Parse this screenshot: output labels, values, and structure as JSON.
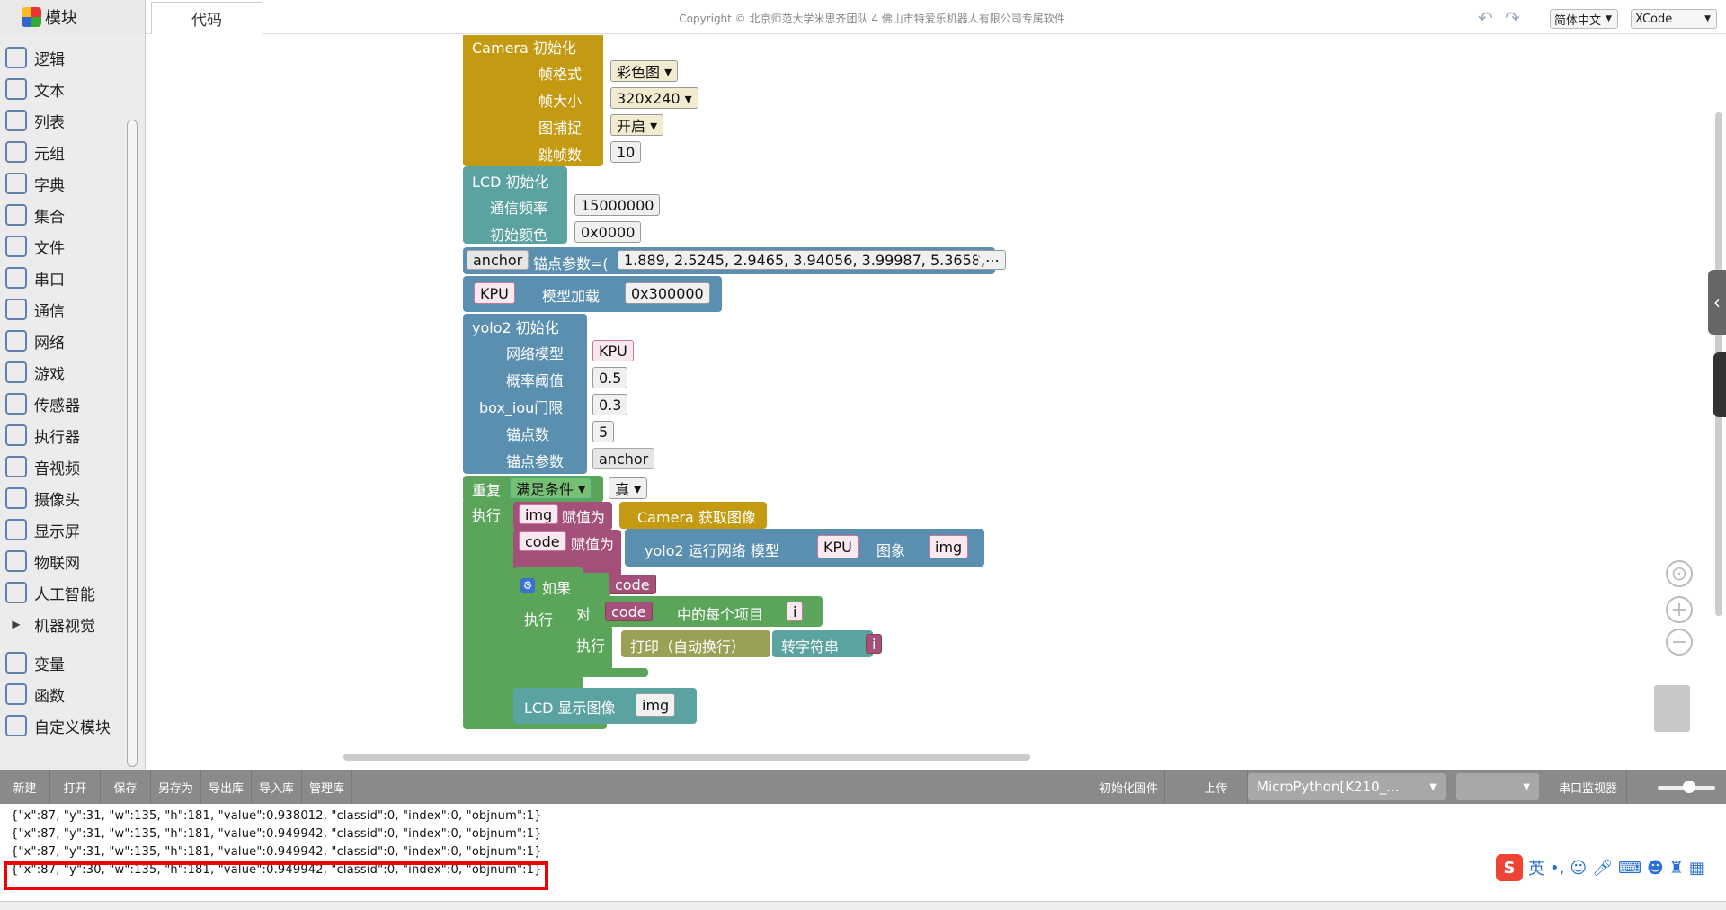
{
  "topbar": {
    "modules_tab": "模块",
    "code_tab": "代码",
    "copyright": "Copyright © 北京师范大学米思齐团队 4 佛山市特爱乐机器人有限公司专属软件",
    "language": "简体中文",
    "theme": "XCode"
  },
  "sidebar": {
    "items": [
      {
        "label": "逻辑",
        "icon": "logic-icon"
      },
      {
        "label": "文本",
        "icon": "text-icon"
      },
      {
        "label": "列表",
        "icon": "list-icon"
      },
      {
        "label": "元组",
        "icon": "tuple-icon"
      },
      {
        "label": "字典",
        "icon": "dict-icon"
      },
      {
        "label": "集合",
        "icon": "set-icon"
      },
      {
        "label": "文件",
        "icon": "file-icon"
      },
      {
        "label": "串口",
        "icon": "serial-icon"
      },
      {
        "label": "通信",
        "icon": "comm-icon"
      },
      {
        "label": "网络",
        "icon": "network-icon"
      },
      {
        "label": "游戏",
        "icon": "game-icon"
      },
      {
        "label": "传感器",
        "icon": "sensor-icon"
      },
      {
        "label": "执行器",
        "icon": "actuator-icon"
      },
      {
        "label": "音视频",
        "icon": "av-icon"
      },
      {
        "label": "摄像头",
        "icon": "camera-icon"
      },
      {
        "label": "显示屏",
        "icon": "display-icon"
      },
      {
        "label": "物联网",
        "icon": "iot-icon"
      },
      {
        "label": "人工智能",
        "icon": "ai-icon"
      },
      {
        "label": "机器视觉",
        "icon": "caret-right-icon"
      },
      {
        "label": "变量",
        "icon": "variable-icon"
      },
      {
        "label": "函数",
        "icon": "function-icon"
      },
      {
        "label": "自定义模块",
        "icon": "custom-module-icon"
      }
    ]
  },
  "blocks": {
    "camera_init": "Camera  初始化",
    "frame_format_lbl": "帧格式",
    "frame_format_val": "彩色图",
    "frame_size_lbl": "帧大小",
    "frame_size_val": "320x240",
    "capture_lbl": "图捕捉",
    "capture_val": "开启",
    "skip_lbl": "跳帧数",
    "skip_val": "10",
    "lcd_init": "LCD 初始化",
    "freq_lbl": "通信频率",
    "freq_val": "15000000",
    "color_lbl": "初始颜色",
    "color_val": "0x0000",
    "anchor_var": "anchor",
    "anchor_lbl": "锚点参数=(",
    "anchor_val": "1.889, 2.5245, 2.9465, 3.94056, 3.99987, 5.3658,⋯",
    "anchor_close": ")",
    "kpu_var": "KPU",
    "model_load_lbl": "模型加载",
    "model_load_val": "0x300000",
    "yolo_init": "yolo2  初始化",
    "net_model_lbl": "网络模型",
    "net_model_val": "KPU",
    "prob_lbl": "概率阈值",
    "prob_val": "0.5",
    "iou_lbl": "box_iou门限",
    "iou_val": "0.3",
    "anchor_num_lbl": "锚点数",
    "anchor_num_val": "5",
    "anchor_param_lbl": "锚点参数",
    "anchor_param_val": "anchor",
    "repeat_lbl": "重复",
    "repeat_mode": "满足条件",
    "repeat_cond": "真",
    "do_lbl": "执行",
    "img_var": "img",
    "assign_lbl": "赋值为",
    "camera_get": "Camera  获取图像",
    "code_var": "code",
    "yolo_run": "yolo2  运行网络  模型",
    "yolo_kpu": "KPU",
    "image_lbl": "图象",
    "yolo_img": "img",
    "if_lbl": "如果",
    "if_cond": "code",
    "do2_lbl": "执行",
    "for_lbl": "对",
    "for_list": "code",
    "for_each_lbl": "中的每个项目",
    "for_var": "i",
    "do3_lbl": "执行",
    "print_lbl": "打印（自动换行）",
    "tostr_lbl": "转字符串",
    "tostr_var": "i",
    "lcd_show": "LCD 显示图像",
    "lcd_img": "img"
  },
  "toolbar": {
    "buttons": [
      "新建",
      "打开",
      "保存",
      "另存为",
      "导出库",
      "导入库",
      "管理库"
    ],
    "init_firmware": "初始化固件",
    "upload": "上传",
    "board": "MicroPython[K210_...",
    "serial_monitor": "串口监视器"
  },
  "console": {
    "lines": [
      "{\"x\":87, \"y\":31, \"w\":135, \"h\":181, \"value\":0.938012, \"classid\":0, \"index\":0, \"objnum\":1}",
      "{\"x\":87, \"y\":31, \"w\":135, \"h\":181, \"value\":0.949942, \"classid\":0, \"index\":0, \"objnum\":1}",
      "{\"x\":87, \"y\":31, \"w\":135, \"h\":181, \"value\":0.949942, \"classid\":0, \"index\":0, \"objnum\":1}",
      "{\"x\":87, \"y\":30, \"w\":135, \"h\":181, \"value\":0.949942, \"classid\":0, \"index\":0, \"objnum\":1}"
    ]
  },
  "ime": {
    "logo": "S",
    "lang": "英"
  },
  "colors": {
    "camera": "#c49a12",
    "lcd": "#5ba3a0",
    "anchor": "#5b8fb0",
    "yolo": "#5b8fb0",
    "loop": "#5ba55b",
    "var": "#a5507b",
    "highlight": "#e00000"
  }
}
